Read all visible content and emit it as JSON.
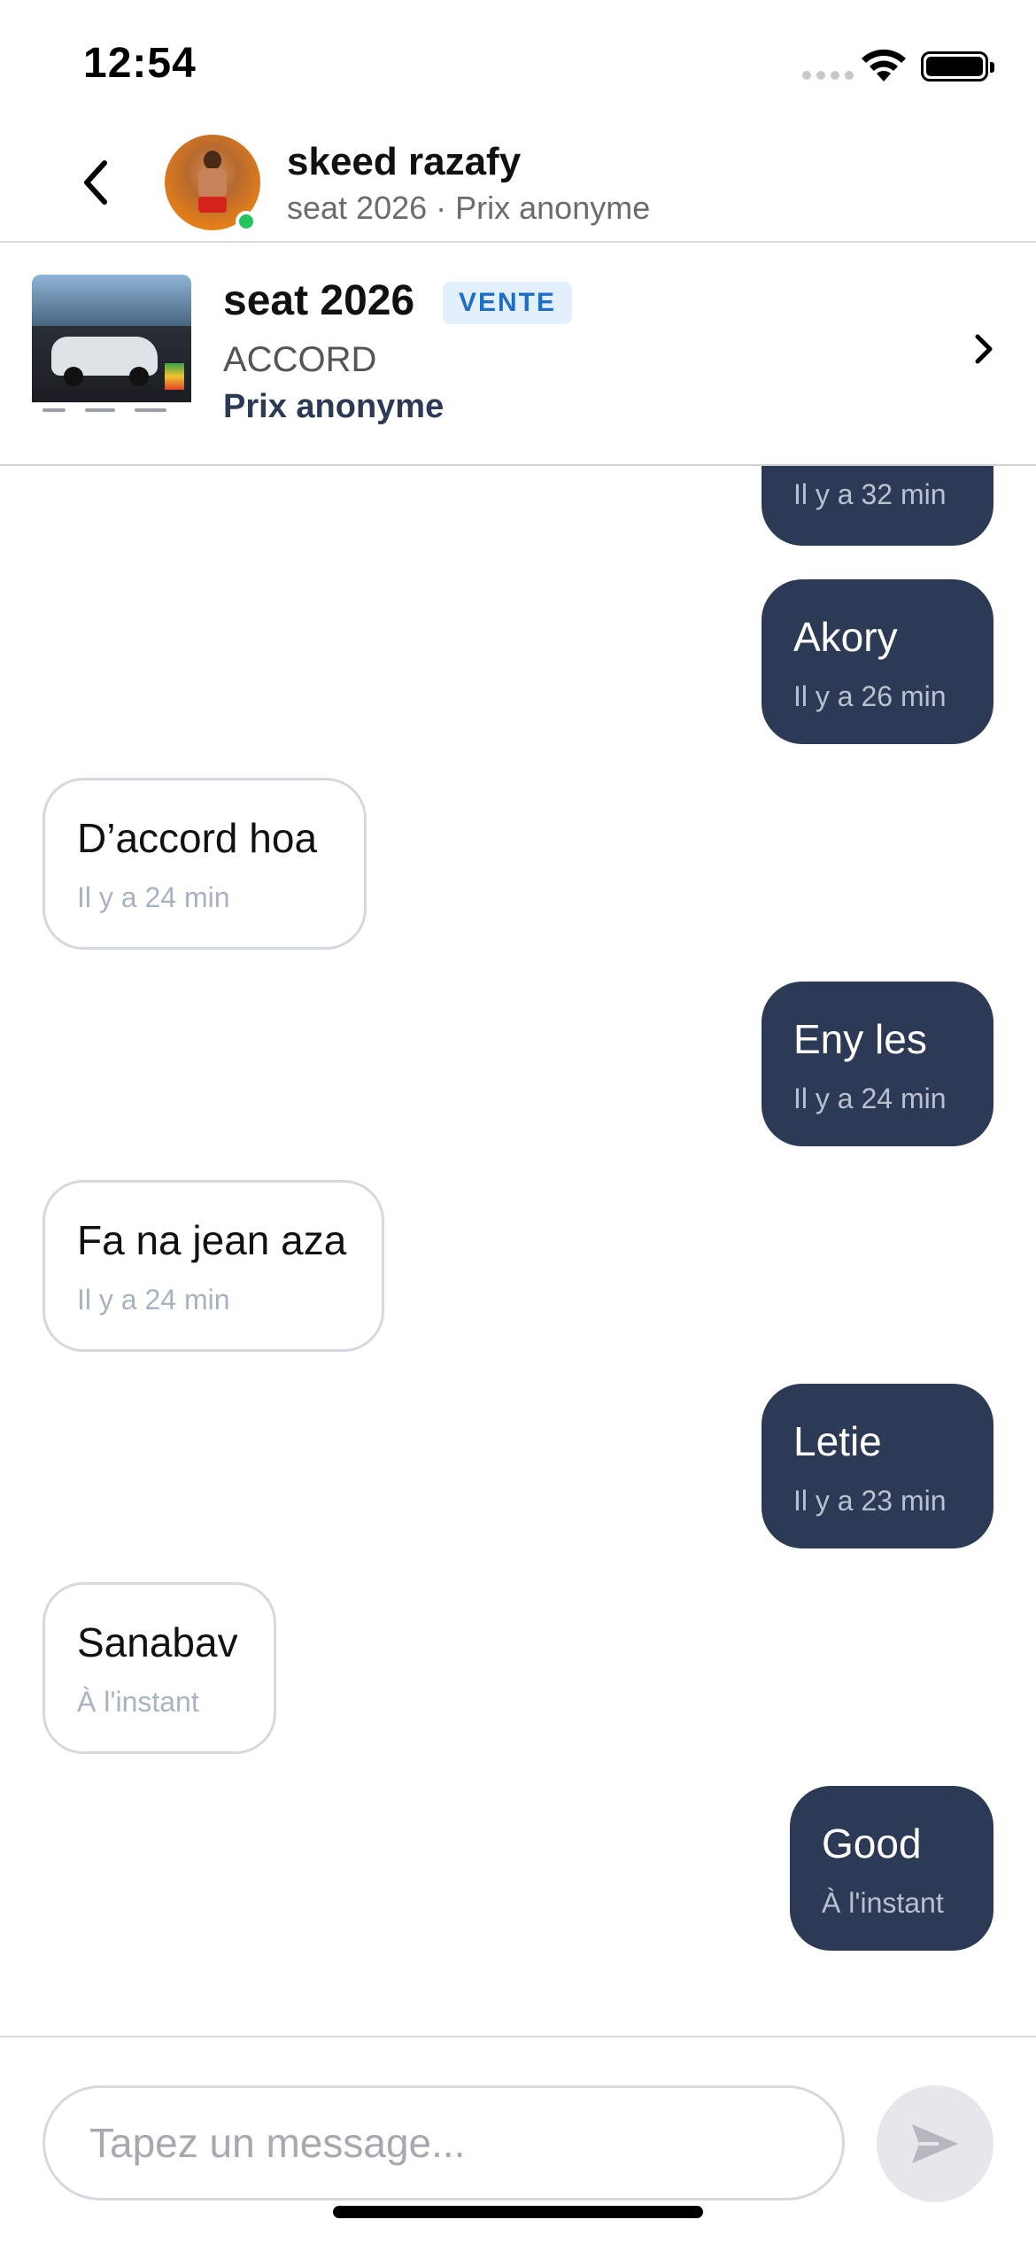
{
  "status_bar": {
    "time": "12:54",
    "icons": [
      "signal-icon",
      "wifi-icon",
      "battery-icon"
    ]
  },
  "header": {
    "back_icon": "chevron-left-icon",
    "contact_name": "skeed razafy",
    "subtitle": "seat 2026 · Prix anonyme",
    "online": true,
    "online_color": "#22c55e"
  },
  "listing": {
    "title": "seat 2026",
    "badge": "VENTE",
    "status": "ACCORD",
    "price": "Prix anonyme",
    "chevron_icon": "chevron-right-icon"
  },
  "messages": [
    {
      "direction": "out",
      "text": "",
      "time": "Il y a 32 min"
    },
    {
      "direction": "out",
      "text": "Akory",
      "time": "Il y a 26 min"
    },
    {
      "direction": "in",
      "text": "D’accord hoa",
      "time": "Il y a 24 min"
    },
    {
      "direction": "out",
      "text": "Eny les",
      "time": "Il y a 24 min"
    },
    {
      "direction": "in",
      "text": "Fa na jean aza",
      "time": "Il y a 24 min"
    },
    {
      "direction": "out",
      "text": "Letie",
      "time": "Il y a 23 min"
    },
    {
      "direction": "in",
      "text": "Sanabav",
      "time": "À l'instant"
    },
    {
      "direction": "out",
      "text": "Good",
      "time": "À l'instant"
    }
  ],
  "composer": {
    "placeholder": "Tapez un message...",
    "value": "",
    "send_icon": "send-icon"
  },
  "colors": {
    "outgoing_bubble": "#2d3a55",
    "incoming_border": "#d5d8dd",
    "badge_bg": "#e3f0fb",
    "badge_text": "#1e6fc4",
    "send_button_bg": "#e6e7ea"
  }
}
